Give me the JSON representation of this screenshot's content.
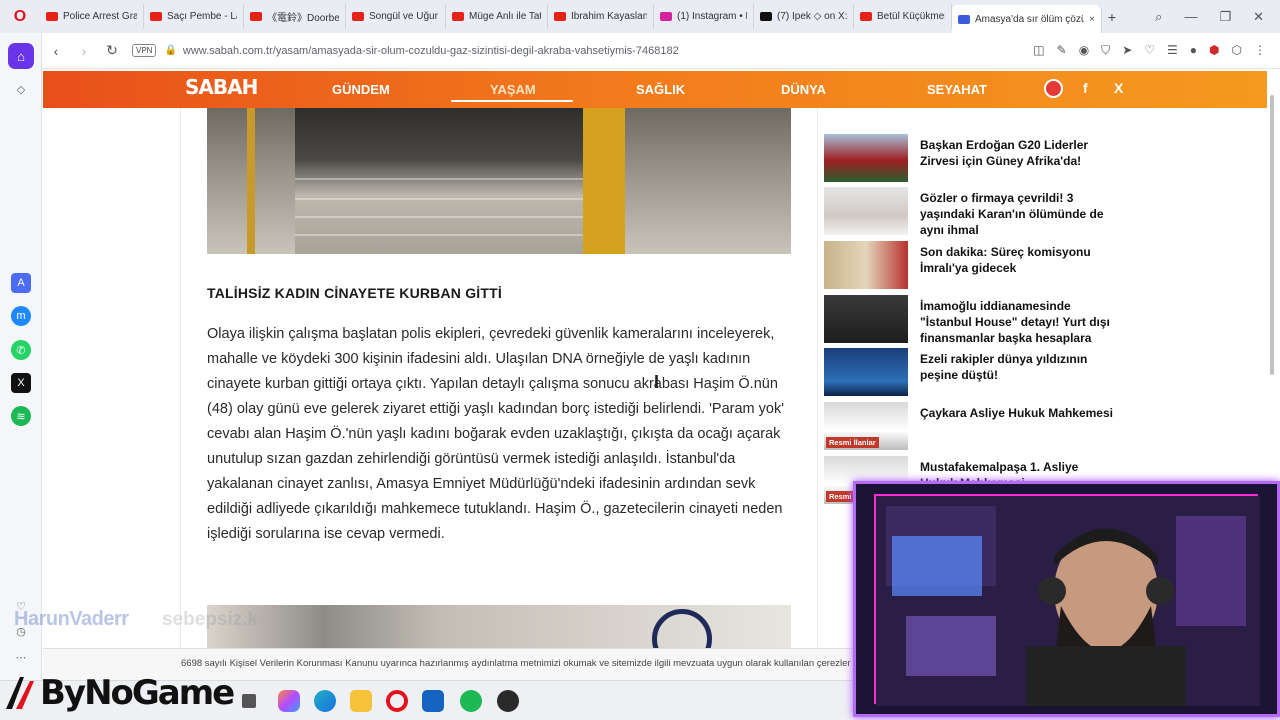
{
  "browser": {
    "tabs": [
      {
        "title": "Police Arrest Gra",
        "favicon_color": "#e62117"
      },
      {
        "title": "Saçı Pembe - Lar",
        "favicon_color": "#e62117"
      },
      {
        "title": "《電鈴》Doorbell",
        "favicon_color": "#e62117"
      },
      {
        "title": "Songül ve Uğur il",
        "favicon_color": "#e62117"
      },
      {
        "title": "Müge Anlı ile Tat",
        "favicon_color": "#e62117"
      },
      {
        "title": "İbrahim Kayaslan",
        "favicon_color": "#e62117"
      },
      {
        "title": "(1) Instagram • M",
        "favicon_color": "#d6249f"
      },
      {
        "title": "(7) İpek ◇ on X:",
        "favicon_color": "#111111"
      },
      {
        "title": "Betül Küçükmeri",
        "favicon_color": "#e62117"
      },
      {
        "title": "Amasya'da sır ölüm çözüld",
        "favicon_color": "#3b5bdb",
        "active": true
      }
    ],
    "tab_close_glyph": "×",
    "new_tab_glyph": "+",
    "address": {
      "vpn_label": "VPN",
      "url": "www.sabah.com.tr/yasam/amasyada-sir-olum-cozuldu-gaz-sizintisi-degil-akraba-vahsetiymis-7468182"
    }
  },
  "site": {
    "logo": "SABAH",
    "nav": [
      "GÜNDEM",
      "YAŞAM",
      "SAĞLIK",
      "DÜNYA",
      "SEYAHAT"
    ],
    "active_nav": "YAŞAM",
    "social": {
      "facebook": "f",
      "x": "X"
    },
    "brand_color": "#f07a1c"
  },
  "article": {
    "subheading": "TALİHSİZ KADIN CİNAYETE KURBAN GİTTİ",
    "body": "Olaya ilişkin çalışma başlatan polis ekipleri, çevredeki güvenlik kameralarını inceleyerek, mahalle ve köydeki 300 kişinin ifadesini aldı. Ulaşılan DNA örneğiyle de yaşlı kadının cinayete kurban gittiği ortaya çıktı. Yapılan detaylı çalışma sonucu akrabası Haşim Ö.nün (48) olay günü eve gelerek ziyaret ettiği yaşlı kadından borç istediği belirlendi. 'Param yok' cevabı alan Haşim Ö.'nün yaşlı kadını boğarak evden uzaklaştığı, çıkışta da ocağı açarak unutulup sızan gazdan zehirlendiği görüntüsü vermek istediği anlaşıldı. İstanbul'da yakalanan cinayet zanlısı, Amasya Emniyet Müdürlüğü'ndeki ifadesinin ardından sevk edildiği adliyede çıkarıldığı mahkemece tutuklandı. Haşim Ö., gazetecilerin cinayeti neden işlediği sorularına ise cevap vermedi."
  },
  "news": [
    {
      "title": "Başkan Erdoğan G20 Liderler Zirvesi için Güney Afrika'da!",
      "thumb": "g20"
    },
    {
      "title": "Gözler o firmaya çevrildi! 3 yaşındaki Karan'ın ölümünde de aynı ihmal",
      "thumb": "child"
    },
    {
      "title": "Son dakika: Süreç komisyonu İmralı'ya gidecek",
      "thumb": "commission"
    },
    {
      "title": "İmamoğlu iddianamesinde \"İstanbul House\" detayı! Yurt dışı finansmanlar başka hesaplara",
      "thumb": "portrait"
    },
    {
      "title": "Ezeli rakipler dünya yıldızının peşine düştü!",
      "thumb": "football"
    },
    {
      "title": "Çaykara Asliye Hukuk Mahkemesi",
      "thumb": "notice",
      "badge": "Resmi İlanlar"
    },
    {
      "title": "Mustafakemalpaşa 1. Asliye Hukuk Mahkemesi",
      "thumb": "notice",
      "badge": "Resmi İlan"
    }
  ],
  "cookie_notice": "6698 sayılı Kişisel Verilerin Korunması Kanunu uyarınca hazırlanmış aydınlatma metnimizi okumak ve sitemizde ilgili mevzuata uygun olarak kullanılan çerezler",
  "overlays": {
    "watermark_left": "HarunVaderr",
    "watermark_right": "sebepsiz.k",
    "brand": "ByNoGame"
  }
}
